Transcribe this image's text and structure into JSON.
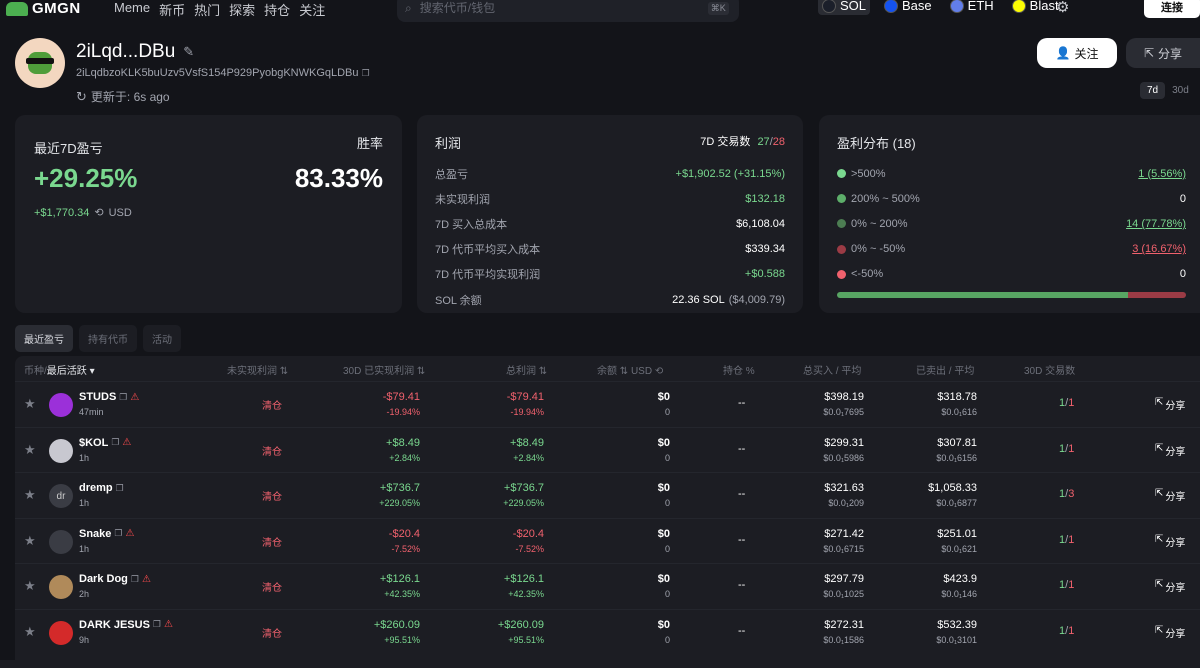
{
  "nav": {
    "brand": "GMGN",
    "links": [
      "Meme",
      "新币",
      "热门",
      "探索",
      "持仓",
      "关注"
    ],
    "search_placeholder": "搜索代币/钱包",
    "search_kbd": "⌘K",
    "chains": [
      {
        "name": "SOL",
        "color": "#1b1f2a",
        "active": true
      },
      {
        "name": "Base",
        "color": "#1452f0",
        "active": false
      },
      {
        "name": "ETH",
        "color": "#627eea",
        "active": false
      },
      {
        "name": "Blast",
        "color": "#fcfc03",
        "active": false
      }
    ],
    "connect": "连接"
  },
  "wallet": {
    "name": "2iLqd...DBu",
    "address": "2iLqdbzoKLK5buUzv5VsfS154P929PyobgKNWKGqLDBu",
    "updated": "更新于: 6s ago"
  },
  "actions": {
    "follow": "关注",
    "share": "分享"
  },
  "period": {
    "options": [
      "7d",
      "30d"
    ],
    "selected": "7d"
  },
  "pnl": {
    "title": "最近7D盈亏",
    "percent": "+29.25%",
    "usd": "+$1,770.34",
    "unit": "USD",
    "winrate_label": "胜率",
    "winrate": "83.33%"
  },
  "profit": {
    "title": "利润",
    "tx_label": "7D 交易数",
    "tx_win": "27",
    "tx_total": "28",
    "rows": [
      {
        "label": "总盈亏",
        "value": "+$1,902.52 (+31.15%)",
        "cls": "green"
      },
      {
        "label": "未实现利润",
        "value": "$132.18",
        "cls": "green"
      },
      {
        "label": "7D 买入总成本",
        "value": "$6,108.04",
        "cls": ""
      },
      {
        "label": "7D 代币平均买入成本",
        "value": "$339.34",
        "cls": ""
      },
      {
        "label": "7D 代币平均实现利润",
        "value": "+$0.588",
        "cls": "green"
      },
      {
        "label": "SOL 余额",
        "value": "22.36 SOL",
        "value2": "($4,009.79)",
        "cls": ""
      }
    ]
  },
  "distribution": {
    "title": "盈利分布 (18)",
    "rows": [
      {
        "label": ">500%",
        "value": "1 (5.56%)",
        "color": "#7ad88f",
        "cls": "green"
      },
      {
        "label": "200% ~ 500%",
        "value": "0",
        "color": "#5dae6a",
        "cls": ""
      },
      {
        "label": "0% ~ 200%",
        "value": "14 (77.78%)",
        "color": "#4c7d52",
        "cls": "green"
      },
      {
        "label": "0% ~ -50%",
        "value": "3 (16.67%)",
        "color": "#9b3b45",
        "cls": "red"
      },
      {
        "label": "<-50%",
        "value": "0",
        "color": "#f0616d",
        "cls": ""
      }
    ],
    "bar": {
      "positive": 0.8334,
      "negative": 0.1666
    }
  },
  "tabs": [
    "最近盈亏",
    "持有代币",
    "活动"
  ],
  "table": {
    "headers": [
      "币种/",
      "最后活跃",
      "未实现利润",
      "30D 已实现利润",
      "总利润",
      "余额",
      "USD",
      "持仓 %",
      "总买入 / 平均",
      "已卖出 / 平均",
      "30D 交易数"
    ],
    "rows": [
      {
        "name": "STUDS",
        "time": "47min",
        "warn": true,
        "ic": "#9b30d9",
        "ic_text": "",
        "unreal": "清仓",
        "real": "-$79.41",
        "real_pct": "-19.94%",
        "total": "-$79.41",
        "total_pct": "-19.94%",
        "bal": "$0",
        "bal_sub": "0",
        "hold": "--",
        "buy": "$398.19",
        "buy_avg": "$0.0₁7695",
        "sell": "$318.78",
        "sell_avg": "$0.0₁616",
        "tx_a": "1",
        "tx_b": "1",
        "share": "分享",
        "pos": false
      },
      {
        "name": "$KOL",
        "time": "1h",
        "warn": true,
        "ic": "#c8c8d0",
        "ic_text": "",
        "unreal": "清仓",
        "real": "+$8.49",
        "real_pct": "+2.84%",
        "total": "+$8.49",
        "total_pct": "+2.84%",
        "bal": "$0",
        "bal_sub": "0",
        "hold": "--",
        "buy": "$299.31",
        "buy_avg": "$0.0₁5986",
        "sell": "$307.81",
        "sell_avg": "$0.0₁6156",
        "tx_a": "1",
        "tx_b": "1",
        "share": "分享",
        "pos": true
      },
      {
        "name": "dremp",
        "time": "1h",
        "warn": false,
        "ic": "#3a3c44",
        "ic_text": "dr",
        "unreal": "清仓",
        "real": "+$736.7",
        "real_pct": "+229.05%",
        "total": "+$736.7",
        "total_pct": "+229.05%",
        "bal": "$0",
        "bal_sub": "0",
        "hold": "--",
        "buy": "$321.63",
        "buy_avg": "$0.0₁209",
        "sell": "$1,058.33",
        "sell_avg": "$0.0₁6877",
        "tx_a": "1",
        "tx_b": "3",
        "share": "分享",
        "pos": true
      },
      {
        "name": "Snake",
        "time": "1h",
        "warn": true,
        "ic": "#3a3c44",
        "ic_text": "",
        "unreal": "清仓",
        "real": "-$20.4",
        "real_pct": "-7.52%",
        "total": "-$20.4",
        "total_pct": "-7.52%",
        "bal": "$0",
        "bal_sub": "0",
        "hold": "--",
        "buy": "$271.42",
        "buy_avg": "$0.0₁6715",
        "sell": "$251.01",
        "sell_avg": "$0.0₁621",
        "tx_a": "1",
        "tx_b": "1",
        "share": "分享",
        "pos": false
      },
      {
        "name": "Dark Dog",
        "time": "2h",
        "warn": true,
        "ic": "#b08a5a",
        "ic_text": "",
        "unreal": "清仓",
        "real": "+$126.1",
        "real_pct": "+42.35%",
        "total": "+$126.1",
        "total_pct": "+42.35%",
        "bal": "$0",
        "bal_sub": "0",
        "hold": "--",
        "buy": "$297.79",
        "buy_avg": "$0.0₁1025",
        "sell": "$423.9",
        "sell_avg": "$0.0₁146",
        "tx_a": "1",
        "tx_b": "1",
        "share": "分享",
        "pos": true
      },
      {
        "name": "DARK JESUS",
        "time": "9h",
        "warn": true,
        "ic": "#d42a2a",
        "ic_text": "",
        "unreal": "清仓",
        "real": "+$260.09",
        "real_pct": "+95.51%",
        "total": "+$260.09",
        "total_pct": "+95.51%",
        "bal": "$0",
        "bal_sub": "0",
        "hold": "--",
        "buy": "$272.31",
        "buy_avg": "$0.0₁1586",
        "sell": "$532.39",
        "sell_avg": "$0.0₁3101",
        "tx_a": "1",
        "tx_b": "1",
        "share": "分享",
        "pos": true
      }
    ]
  }
}
